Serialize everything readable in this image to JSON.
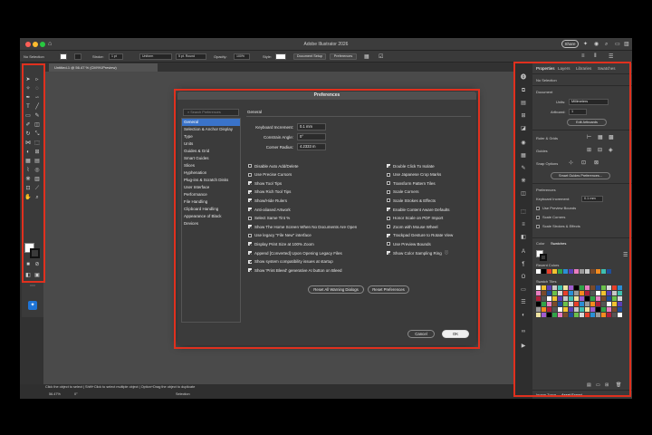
{
  "app": {
    "title": "Adobe Illustrator 2026",
    "share_label": "Share",
    "document_tab": "Untitled-1 @ 56.47 % (CMYK/Preview)"
  },
  "control_bar": {
    "selection": "No Selection",
    "stroke_label": "Stroke:",
    "stroke_weight": "1 pt",
    "uniform": "Uniform",
    "brush": "5 pt. Round",
    "opacity_label": "Opacity:",
    "opacity_value": "100%",
    "style_label": "Style:",
    "document_setup": "Document Setup",
    "preferences": "Preferences"
  },
  "status_bar": {
    "hint": "Click the object to select  |  Shift+Click to select multiple object  |  Option+Drag the object to duplicate",
    "zoom": "56.47%",
    "rotation": "0°",
    "tool": "Selection"
  },
  "right_panel": {
    "tabs": [
      "Properties",
      "Layers",
      "Libraries",
      "Swatches"
    ],
    "no_selection": "No Selection",
    "document_heading": "Document",
    "units_label": "Units:",
    "units_value": "Millimeters",
    "artboard_label": "Artboard:",
    "artboard_value": "1",
    "edit_artboards": "Edit Artboards",
    "ruler_grids": "Ruler & Grids",
    "guides": "Guides",
    "snap_options": "Snap Options",
    "smart_guides_prefs": "Smart Guides Preferences...",
    "preferences_heading": "Preferences",
    "keyboard_increment_label": "Keyboard Increment:",
    "keyboard_increment_value": "0.1 mm",
    "checks": [
      "Use Preview Bounds",
      "Scale Corners",
      "Scale Strokes & Effects"
    ],
    "bottom_tabs": [
      "Color",
      "Swatches"
    ],
    "recent_colors": "Recent Colors",
    "swatch_tiles": "Swatch Tiles",
    "footer_tabs": [
      "Image Trace",
      "Asset Export"
    ]
  },
  "dialog": {
    "title": "Preferences",
    "search_placeholder": "Search Preferences",
    "categories": [
      "General",
      "Selection & Anchor Display",
      "Type",
      "Units",
      "Guides & Grid",
      "Smart Guides",
      "Slices",
      "Hyphenation",
      "Plug-ins & Scratch Disks",
      "User Interface",
      "Performance",
      "File Handling",
      "Clipboard Handling",
      "Appearance of Black",
      "Devices"
    ],
    "selected_category": "General",
    "section_title": "General",
    "fields": {
      "keyboard_increment_label": "Keyboard Increment:",
      "keyboard_increment_value": "0.1 mm",
      "constrain_angle_label": "Constrain Angle:",
      "constrain_angle_value": "0°",
      "corner_radius_label": "Corner Radius:",
      "corner_radius_value": "4.2333 m"
    },
    "left_options": [
      {
        "label": "Disable Auto Add/Delete",
        "checked": false
      },
      {
        "label": "Use Precise Cursors",
        "checked": false
      },
      {
        "label": "Show Tool Tips",
        "checked": true
      },
      {
        "label": "Show Rich Tool Tips",
        "checked": true
      },
      {
        "label": "Show/Hide Rulers",
        "checked": true
      },
      {
        "label": "Anti-aliased Artwork",
        "checked": true
      },
      {
        "label": "Select Same Tint %",
        "checked": false
      },
      {
        "label": "Show The Home Screen When No Documents Are Open",
        "checked": true
      },
      {
        "label": "Use legacy \"File New\" interface",
        "checked": false
      },
      {
        "label": "Display Print Size at 100% Zoom",
        "checked": true
      },
      {
        "label": "Append [Converted] Upon Opening Legacy Files",
        "checked": true
      },
      {
        "label": "Show system compatibility issues at startup",
        "checked": true
      },
      {
        "label": "Show 'Print Bleed' generative AI button on Bleed",
        "checked": true
      }
    ],
    "right_options": [
      {
        "label": "Double Click To Isolate",
        "checked": true
      },
      {
        "label": "Use Japanese Crop Marks",
        "checked": false
      },
      {
        "label": "Transform Pattern Tiles",
        "checked": false
      },
      {
        "label": "Scale Corners",
        "checked": false
      },
      {
        "label": "Scale Strokes & Effects",
        "checked": false
      },
      {
        "label": "Enable Content Aware Defaults",
        "checked": true
      },
      {
        "label": "Honor Scale on PDF Import",
        "checked": false
      },
      {
        "label": "Zoom with Mouse Wheel",
        "checked": false
      },
      {
        "label": "Trackpad Gesture to Rotate View",
        "checked": true
      },
      {
        "label": "Use Preview Bounds",
        "checked": false
      },
      {
        "label": "Show Color Sampling Ring",
        "checked": true
      }
    ],
    "reset_warnings": "Reset All Warning Dialogs",
    "reset_preferences": "Reset Preferences",
    "cancel": "Cancel",
    "ok": "OK"
  },
  "colors": {
    "highlight": "#e0301e",
    "selection_blue": "#3a73c9",
    "generate_blue": "#1e74d6"
  },
  "icons": [
    "home-icon",
    "search-icon",
    "gear-icon",
    "selection-tool-icon",
    "pen-tool-icon",
    "type-tool-icon",
    "zoom-tool-icon",
    "generate-icon"
  ]
}
